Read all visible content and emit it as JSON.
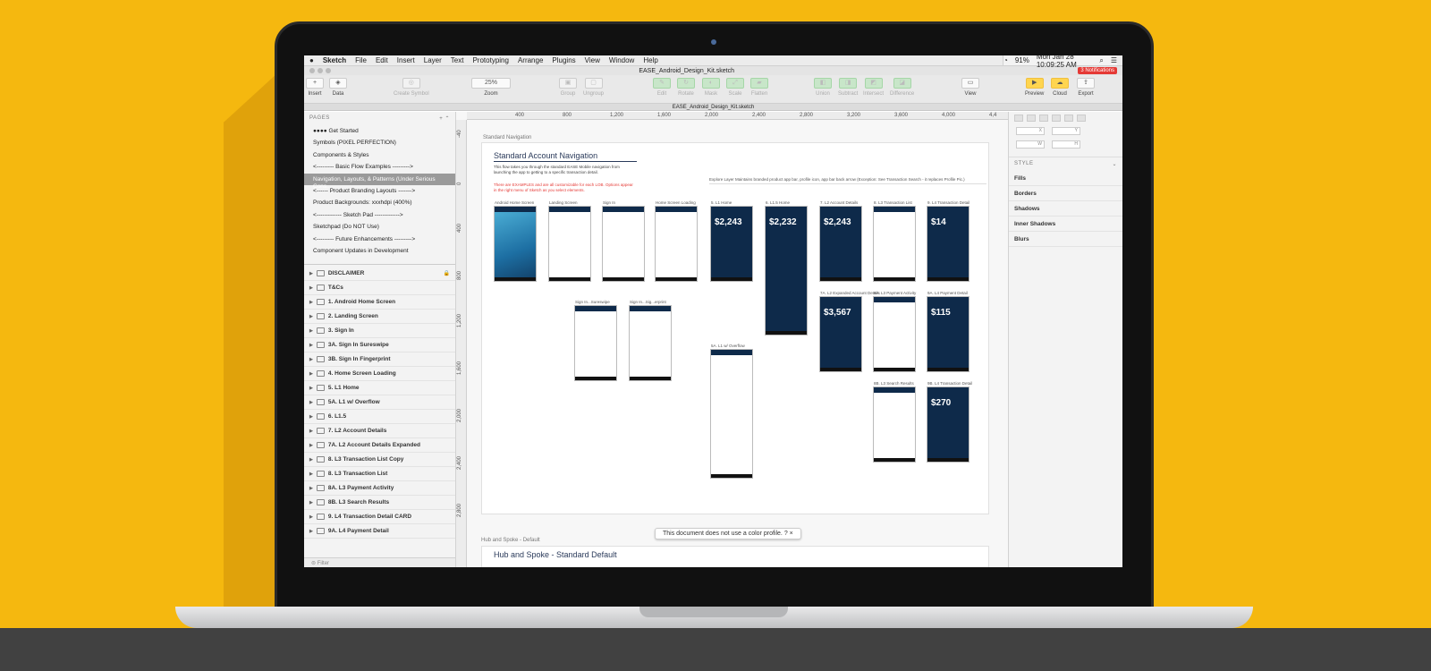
{
  "menubar": {
    "apple": "",
    "app": "Sketch",
    "items": [
      "File",
      "Edit",
      "Insert",
      "Layer",
      "Text",
      "Prototyping",
      "Arrange",
      "Plugins",
      "View",
      "Window",
      "Help"
    ],
    "battery": "91%",
    "clock": "Mon Jan 28  10:09:25 AM",
    "notifications": "3 Notifications"
  },
  "titlebar": {
    "title": "EASE_Android_Design_Kit.sketch"
  },
  "toolbar": {
    "insert": "Insert",
    "data": "Data",
    "create_symbol": "Create Symbol",
    "zoom": "Zoom",
    "zoom_value": "25%",
    "group": "Group",
    "ungroup": "Ungroup",
    "edit": "Edit",
    "rotate": "Rotate",
    "mask": "Mask",
    "scale": "Scale",
    "flatten": "Flatten",
    "union": "Union",
    "subtract": "Subtract",
    "intersect": "Intersect",
    "difference": "Difference",
    "view": "View",
    "preview": "Preview",
    "cloud": "Cloud",
    "export": "Export"
  },
  "tab": {
    "title": "EASE_Android_Design_Kit.sketch"
  },
  "pages": {
    "header": "PAGES",
    "items": [
      "Get Started",
      "Symbols (PIXEL PERFECTION)",
      "Components & Styles",
      "<--------- Basic Flow Examples --------->",
      "Navigation, Layouts, & Patterns (Under Serious Cons...",
      "<------ Product Branding Layouts ------->",
      "Product Backgrounds: xxxhdpi (400%)",
      "<------------- Sketch Pad ------------->",
      "Sketchpad (Do NOT Use)",
      "<--------- Future Enhancements --------->",
      "Component Updates in Development"
    ]
  },
  "layers": [
    "DISCLAIMER",
    "T&Cs",
    "1. Android Home Screen",
    "2. Landing Screen",
    "3. Sign In",
    "3A. Sign In Sureswipe",
    "3B. Sign In Fingerprint",
    "4. Home Screen Loading",
    "5. L1 Home",
    "5A. L1 w/ Overflow",
    "6. L1.5",
    "7. L2 Account Details",
    "7A. L2 Account Details Expanded",
    "8. L3 Transaction List Copy",
    "8. L3 Transaction List",
    "8A. L3 Payment Activity",
    "8B. L3 Search Results",
    "9. L4 Transaction Detail CARD",
    "9A. L4 Payment Detail"
  ],
  "filter": {
    "placeholder": "Filter"
  },
  "ruler": {
    "h": [
      "400",
      "800",
      "1,200",
      "1,600",
      "2,000",
      "2,400",
      "2,800",
      "3,200",
      "3,600",
      "4,000",
      "4,4"
    ],
    "v": [
      "-40",
      "0",
      "400",
      "800",
      "1,200",
      "1,600",
      "2,000",
      "2,400",
      "2,800"
    ]
  },
  "canvas": {
    "artboard_label": "Standard Navigation",
    "title": "Standard Account Navigation",
    "desc": "This flow takes you through the standard EASE Mobile navigation from launching the app to getting to a specific transaction detail.",
    "red": "There are EXAMPLES and are all customizable for each LOB. Options appear in the right menu of Sketch as you select elements.",
    "explore": "Explore Layer   Maintains branded product app bar, profile icon, app bar back arrow (Exception: See Transaction Search - it replaces Profile Pic.)",
    "phones": [
      {
        "label": "Android Home Screen",
        "amount": ""
      },
      {
        "label": "Landing Screen",
        "amount": ""
      },
      {
        "label": "Sign In",
        "amount": ""
      },
      {
        "label": "Home Screen Loading",
        "amount": ""
      },
      {
        "label": "5. L1 Home",
        "amount": "$2,243"
      },
      {
        "label": "6. L1.5 Home",
        "amount": "$2,232"
      },
      {
        "label": "7. L2 Account Details",
        "amount": "$2,243"
      },
      {
        "label": "8. L3 Transaction List",
        "amount": ""
      },
      {
        "label": "9. L4 Transaction Detail",
        "amount": "$14"
      },
      {
        "label": "Sign In...Sureswipe",
        "amount": ""
      },
      {
        "label": "Sign In...Sig...erprint",
        "amount": ""
      },
      {
        "label": "5A. L1 w/ Overflow",
        "amount": ""
      },
      {
        "label": "7A. L2 Expanded Account Details",
        "amount": "$3,567"
      },
      {
        "label": "8A. L3 Payment Activity",
        "amount": ""
      },
      {
        "label": "9A. L4 Payment Detail",
        "amount": "$115"
      },
      {
        "label": "8B. L3 Search Results",
        "amount": ""
      },
      {
        "label": "9B. L4 Transaction Detail",
        "amount": "$270"
      }
    ],
    "toast": "This document does not use a color profile.",
    "hub_label": "Hub and Spoke - Default",
    "hub_title": "Hub and Spoke - Standard Default"
  },
  "inspector": {
    "fields": [
      "X",
      "Y",
      "W",
      "H"
    ],
    "style_header": "STYLE",
    "style_items": [
      "Fills",
      "Borders",
      "Shadows",
      "Inner Shadows",
      "Blurs"
    ]
  }
}
